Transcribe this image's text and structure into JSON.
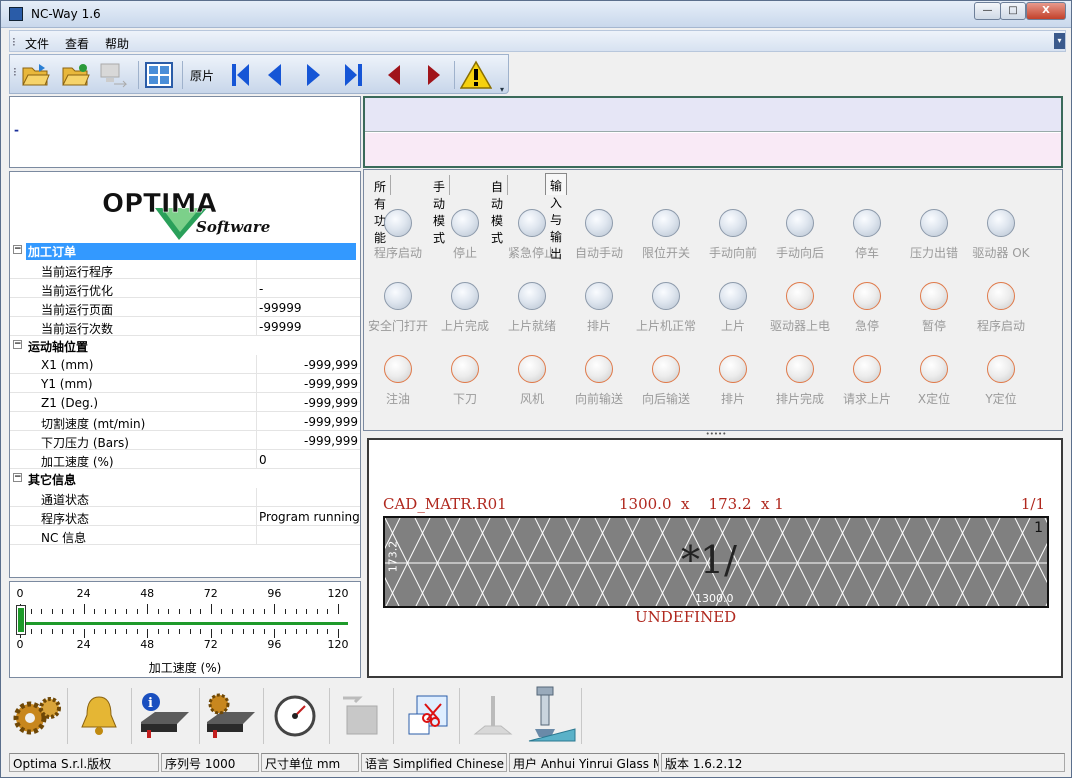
{
  "window": {
    "title": "NC-Way 1.6",
    "min": "—",
    "max": "□",
    "close": "X"
  },
  "menu": {
    "file": "文件",
    "view": "查看",
    "help": "帮助"
  },
  "toolbar": {
    "sheet_label": "原片"
  },
  "message": {
    "text": "-"
  },
  "tree": {
    "sections": [
      {
        "title": "加工订单",
        "expanded": true,
        "rows": [
          {
            "key": "当前运行程序",
            "value": ""
          },
          {
            "key": "当前运行优化",
            "value": "-"
          },
          {
            "key": "当前运行页面",
            "value": "-99999"
          },
          {
            "key": "当前运行次数",
            "value": "-99999"
          }
        ]
      },
      {
        "title": "运动轴位置",
        "expanded": true,
        "rows": [
          {
            "key": "X1 (mm)",
            "value": "-999,999"
          },
          {
            "key": "Y1 (mm)",
            "value": "-999,999"
          },
          {
            "key": "Z1 (Deg.)",
            "value": "-999,999"
          },
          {
            "key": "切割速度 (mt/min)",
            "value": "-999,999"
          },
          {
            "key": "下刀压力 (Bars)",
            "value": "-999,999"
          },
          {
            "key": "加工速度 (%)",
            "value": "0"
          }
        ]
      },
      {
        "title": "其它信息",
        "expanded": true,
        "rows": [
          {
            "key": "通道状态",
            "value": ""
          },
          {
            "key": "程序状态",
            "value": "Program running"
          },
          {
            "key": "NC 信息",
            "value": ""
          }
        ]
      }
    ]
  },
  "speed_slider": {
    "label": "加工速度 (%)",
    "ticks": [
      "0",
      "24",
      "48",
      "72",
      "96",
      "120"
    ],
    "value": 0
  },
  "tabs": [
    {
      "label": "所有功能",
      "active": false
    },
    {
      "label": "手动模式",
      "active": false
    },
    {
      "label": "自动模式",
      "active": false
    },
    {
      "label": "输入与输出",
      "active": true
    }
  ],
  "io_indicators": [
    {
      "label": "程序启动",
      "active": false
    },
    {
      "label": "停止",
      "active": false
    },
    {
      "label": "紧急停止",
      "active": false
    },
    {
      "label": "自动手动",
      "active": false
    },
    {
      "label": "限位开关",
      "active": false
    },
    {
      "label": "手动向前",
      "active": false
    },
    {
      "label": "手动向后",
      "active": false
    },
    {
      "label": "停车",
      "active": false
    },
    {
      "label": "压力出错",
      "active": false
    },
    {
      "label": "驱动器 OK",
      "active": false
    },
    {
      "label": "安全门打开",
      "active": false
    },
    {
      "label": "上片完成",
      "active": false
    },
    {
      "label": "上片就绪",
      "active": false
    },
    {
      "label": "排片",
      "active": false
    },
    {
      "label": "上片机正常",
      "active": false
    },
    {
      "label": "上片",
      "active": false
    },
    {
      "label": "驱动器上电",
      "active": true
    },
    {
      "label": "急停",
      "active": true
    },
    {
      "label": "暂停",
      "active": true
    },
    {
      "label": "程序启动",
      "active": true
    },
    {
      "label": "注油",
      "active": true
    },
    {
      "label": "下刀",
      "active": true
    },
    {
      "label": "风机",
      "active": true
    },
    {
      "label": "向前输送",
      "active": true
    },
    {
      "label": "向后输送",
      "active": true
    },
    {
      "label": "排片",
      "active": true
    },
    {
      "label": "排片完成",
      "active": true
    },
    {
      "label": "请求上片",
      "active": true
    },
    {
      "label": "X定位",
      "active": true
    },
    {
      "label": "Y定位",
      "active": true
    }
  ],
  "cad": {
    "name": "CAD_MATR.R01",
    "dims": "1300.0  x    173.2  x 1",
    "page": "1/1",
    "piece_label": "*1/",
    "width_label": "1300.0",
    "height_label": "173.2",
    "corner_mark": "1",
    "material": "UNDEFINED",
    "color": "#b0281e"
  },
  "status": {
    "copyright": "Optima S.r.l.版权",
    "serial": "序列号 1000",
    "unit": "尺寸单位 mm",
    "language": "语言 Simplified Chinese",
    "user": "用户 Anhui Yinrui Glass Ma",
    "version": "版本 1.6.2.12"
  },
  "colors": {
    "selection": "#3399ff",
    "led_on_ring": "#e07a4a",
    "cad_fill": "#808080"
  }
}
